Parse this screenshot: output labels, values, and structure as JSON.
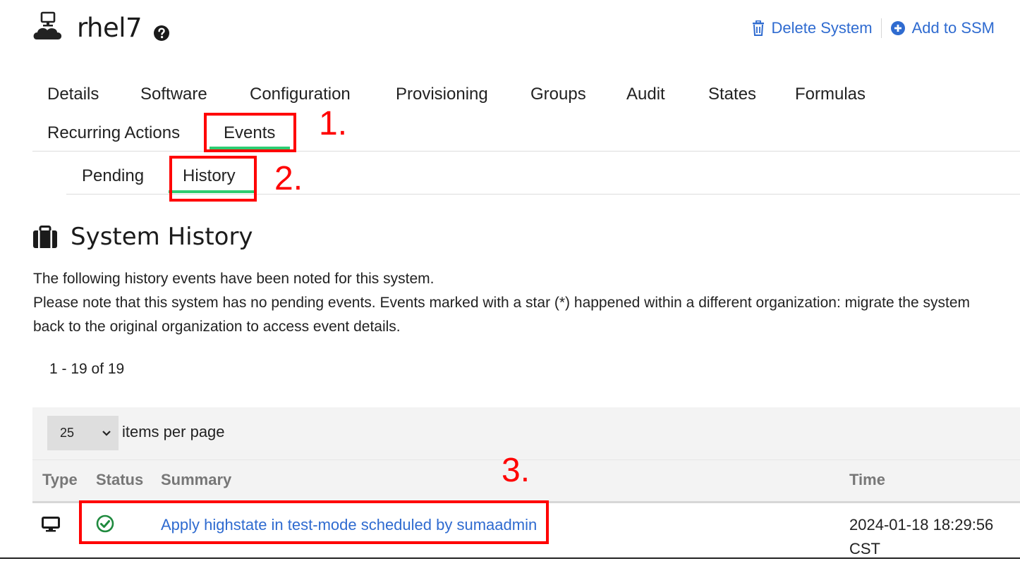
{
  "header": {
    "system_name": "rhel7",
    "actions": [
      {
        "label": "Delete System",
        "icon": "trash-icon"
      },
      {
        "label": "Add to SSM",
        "icon": "plus-circle-icon"
      }
    ]
  },
  "tabs": [
    "Details",
    "Software",
    "Configuration",
    "Provisioning",
    "Groups",
    "Audit",
    "States",
    "Formulas",
    "Recurring Actions",
    "Events"
  ],
  "subtabs": [
    "Pending",
    "History"
  ],
  "active_tab": "Events",
  "active_subtab": "History",
  "annotations": [
    "1.",
    "2.",
    "3."
  ],
  "section": {
    "title": "System History",
    "desc_lines": [
      "The following history events have been noted for this system.",
      "Please note that this system has no pending events. Events marked with a star (*) happened within a different organization: migrate the system",
      "back to the original organization to access event details."
    ],
    "pagination": "1 - 19 of 19"
  },
  "table": {
    "per_page_value": "25",
    "per_page_label": "items per page",
    "columns": [
      "Type",
      "Status",
      "Summary",
      "Time"
    ],
    "rows": [
      {
        "type_icon": "monitor-icon",
        "status_icon": "check-circle-icon",
        "summary": "Apply highstate in test-mode scheduled by sumaadmin",
        "time_line1": "2024-01-18 18:29:56",
        "time_line2": "CST"
      }
    ]
  },
  "colors": {
    "link": "#2f6bd0",
    "accent_green": "#2ecc71",
    "annotation_red": "#ff0000",
    "status_ok": "#1f8a3e"
  }
}
